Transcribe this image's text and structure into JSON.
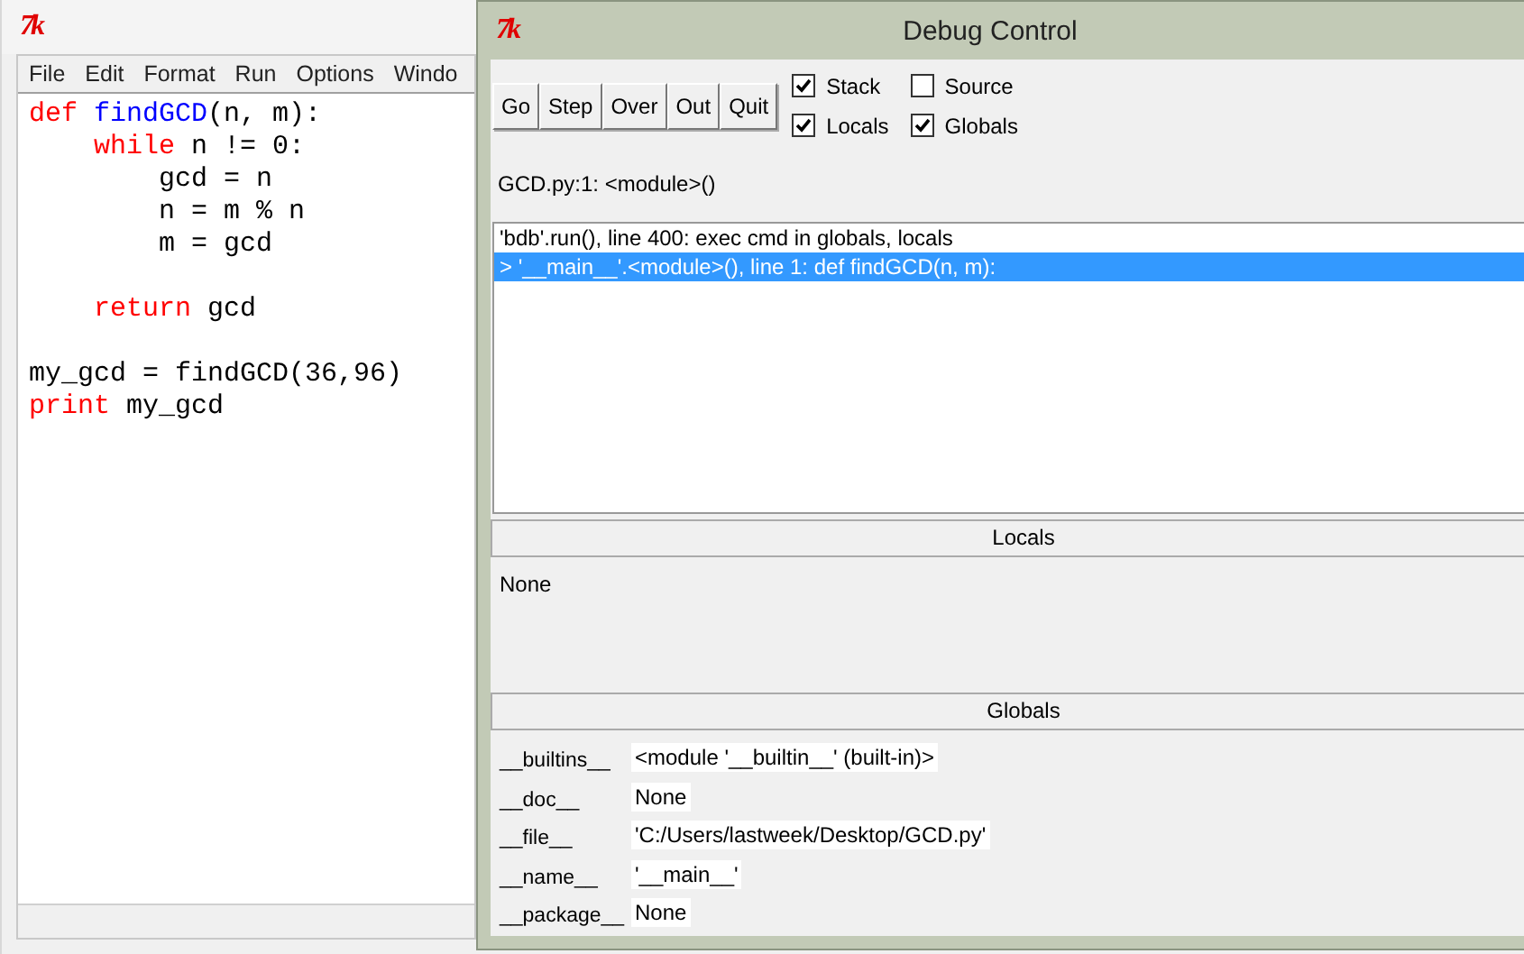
{
  "editor": {
    "logo": "7k",
    "menu": [
      "File",
      "Edit",
      "Format",
      "Run",
      "Options",
      "Windo"
    ],
    "code_blocks": [
      {
        "lines": [
          [
            {
              "text": "def",
              "kind": "keyword"
            },
            {
              "text": " findGCD",
              "kind": "name"
            },
            {
              "text": "(n, m):",
              "kind": "plain"
            }
          ],
          [
            {
              "text": "    while",
              "kind": "keyword"
            },
            {
              "text": " n != 0:",
              "kind": "plain"
            }
          ],
          [
            {
              "text": "        gcd = n",
              "kind": "plain"
            }
          ],
          [
            {
              "text": "        n = m % n",
              "kind": "plain"
            }
          ],
          [
            {
              "text": "        m = gcd",
              "kind": "plain"
            }
          ]
        ]
      },
      {
        "lines": [
          [
            {
              "text": "    return",
              "kind": "keyword"
            },
            {
              "text": " gcd",
              "kind": "plain"
            }
          ]
        ]
      },
      {
        "lines": [
          [
            {
              "text": "my_gcd = findGCD(36,96)",
              "kind": "plain"
            }
          ],
          [
            {
              "text": "print",
              "kind": "keyword"
            },
            {
              "text": " my_gcd",
              "kind": "plain"
            }
          ]
        ]
      }
    ]
  },
  "debug": {
    "logo": "7k",
    "title": "Debug Control",
    "buttons": [
      "Go",
      "Step",
      "Over",
      "Out",
      "Quit"
    ],
    "options": [
      {
        "label": "Stack",
        "checked": true
      },
      {
        "label": "Source",
        "checked": false
      },
      {
        "label": "Locals",
        "checked": true
      },
      {
        "label": "Globals",
        "checked": true
      }
    ],
    "status": "GCD.py:1: <module>()",
    "stack": [
      {
        "text": "'bdb'.run(), line 400: exec cmd in globals, locals",
        "selected": false
      },
      {
        "text": "> '__main__'.<module>(), line 1: def findGCD(n, m):",
        "selected": true
      }
    ],
    "locals": {
      "header": "Locals",
      "text": "None"
    },
    "globals": {
      "header": "Globals",
      "rows": [
        {
          "name": "__builtins__",
          "value": "<module '__builtin__' (built-in)>"
        },
        {
          "name": "__doc__",
          "value": "None"
        },
        {
          "name": "__file__",
          "value": "'C:/Users/lastweek/Desktop/GCD.py'"
        },
        {
          "name": "__name__",
          "value": "'__main__'"
        },
        {
          "name": "__package__",
          "value": "None"
        }
      ]
    }
  }
}
